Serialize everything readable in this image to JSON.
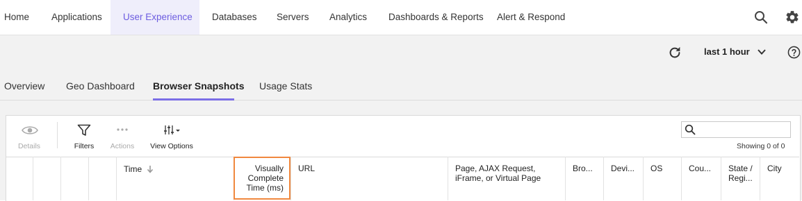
{
  "nav": {
    "items": [
      {
        "label": "Home"
      },
      {
        "label": "Applications"
      },
      {
        "label": "User Experience",
        "active": true
      },
      {
        "label": "Databases"
      },
      {
        "label": "Servers"
      },
      {
        "label": "Analytics"
      },
      {
        "label": "Dashboards & Reports"
      },
      {
        "label": "Alert & Respond"
      }
    ],
    "search_icon": "search-icon",
    "settings_icon": "gear-icon"
  },
  "timebar": {
    "refresh_icon": "refresh-icon",
    "range_label": "last 1 hour",
    "dropdown_icon": "chevron-down-icon",
    "help_icon": "help-icon"
  },
  "subtabs": [
    {
      "label": "Overview"
    },
    {
      "label": "Geo Dashboard"
    },
    {
      "label": "Browser Snapshots",
      "active": true
    },
    {
      "label": "Usage Stats"
    }
  ],
  "toolbar": {
    "details": {
      "label": "Details",
      "icon": "eye-icon",
      "enabled": false
    },
    "filters": {
      "label": "Filters",
      "icon": "filter-icon",
      "enabled": true
    },
    "actions": {
      "label": "Actions",
      "icon": "more-dots-icon",
      "enabled": false
    },
    "view_options": {
      "label": "View Options",
      "icon": "sliders-icon",
      "enabled": true
    },
    "search_placeholder": "",
    "showing": "Showing 0 of 0"
  },
  "table": {
    "columns": [
      {
        "label": ""
      },
      {
        "label": ""
      },
      {
        "label": ""
      },
      {
        "label": ""
      },
      {
        "label": "Time",
        "sorted": "desc"
      },
      {
        "label": "Visually Complete Time (ms)",
        "highlighted": true
      },
      {
        "label": "URL"
      },
      {
        "label": "Page, AJAX Request, iFrame, or Virtual Page"
      },
      {
        "label": "Bro..."
      },
      {
        "label": "Devi..."
      },
      {
        "label": "OS"
      },
      {
        "label": "Cou..."
      },
      {
        "label": "State / Regi..."
      },
      {
        "label": "City"
      }
    ]
  },
  "colors": {
    "accent": "#6c5ce0",
    "active_bg": "#efeefb",
    "highlight_border": "#f0883e"
  }
}
